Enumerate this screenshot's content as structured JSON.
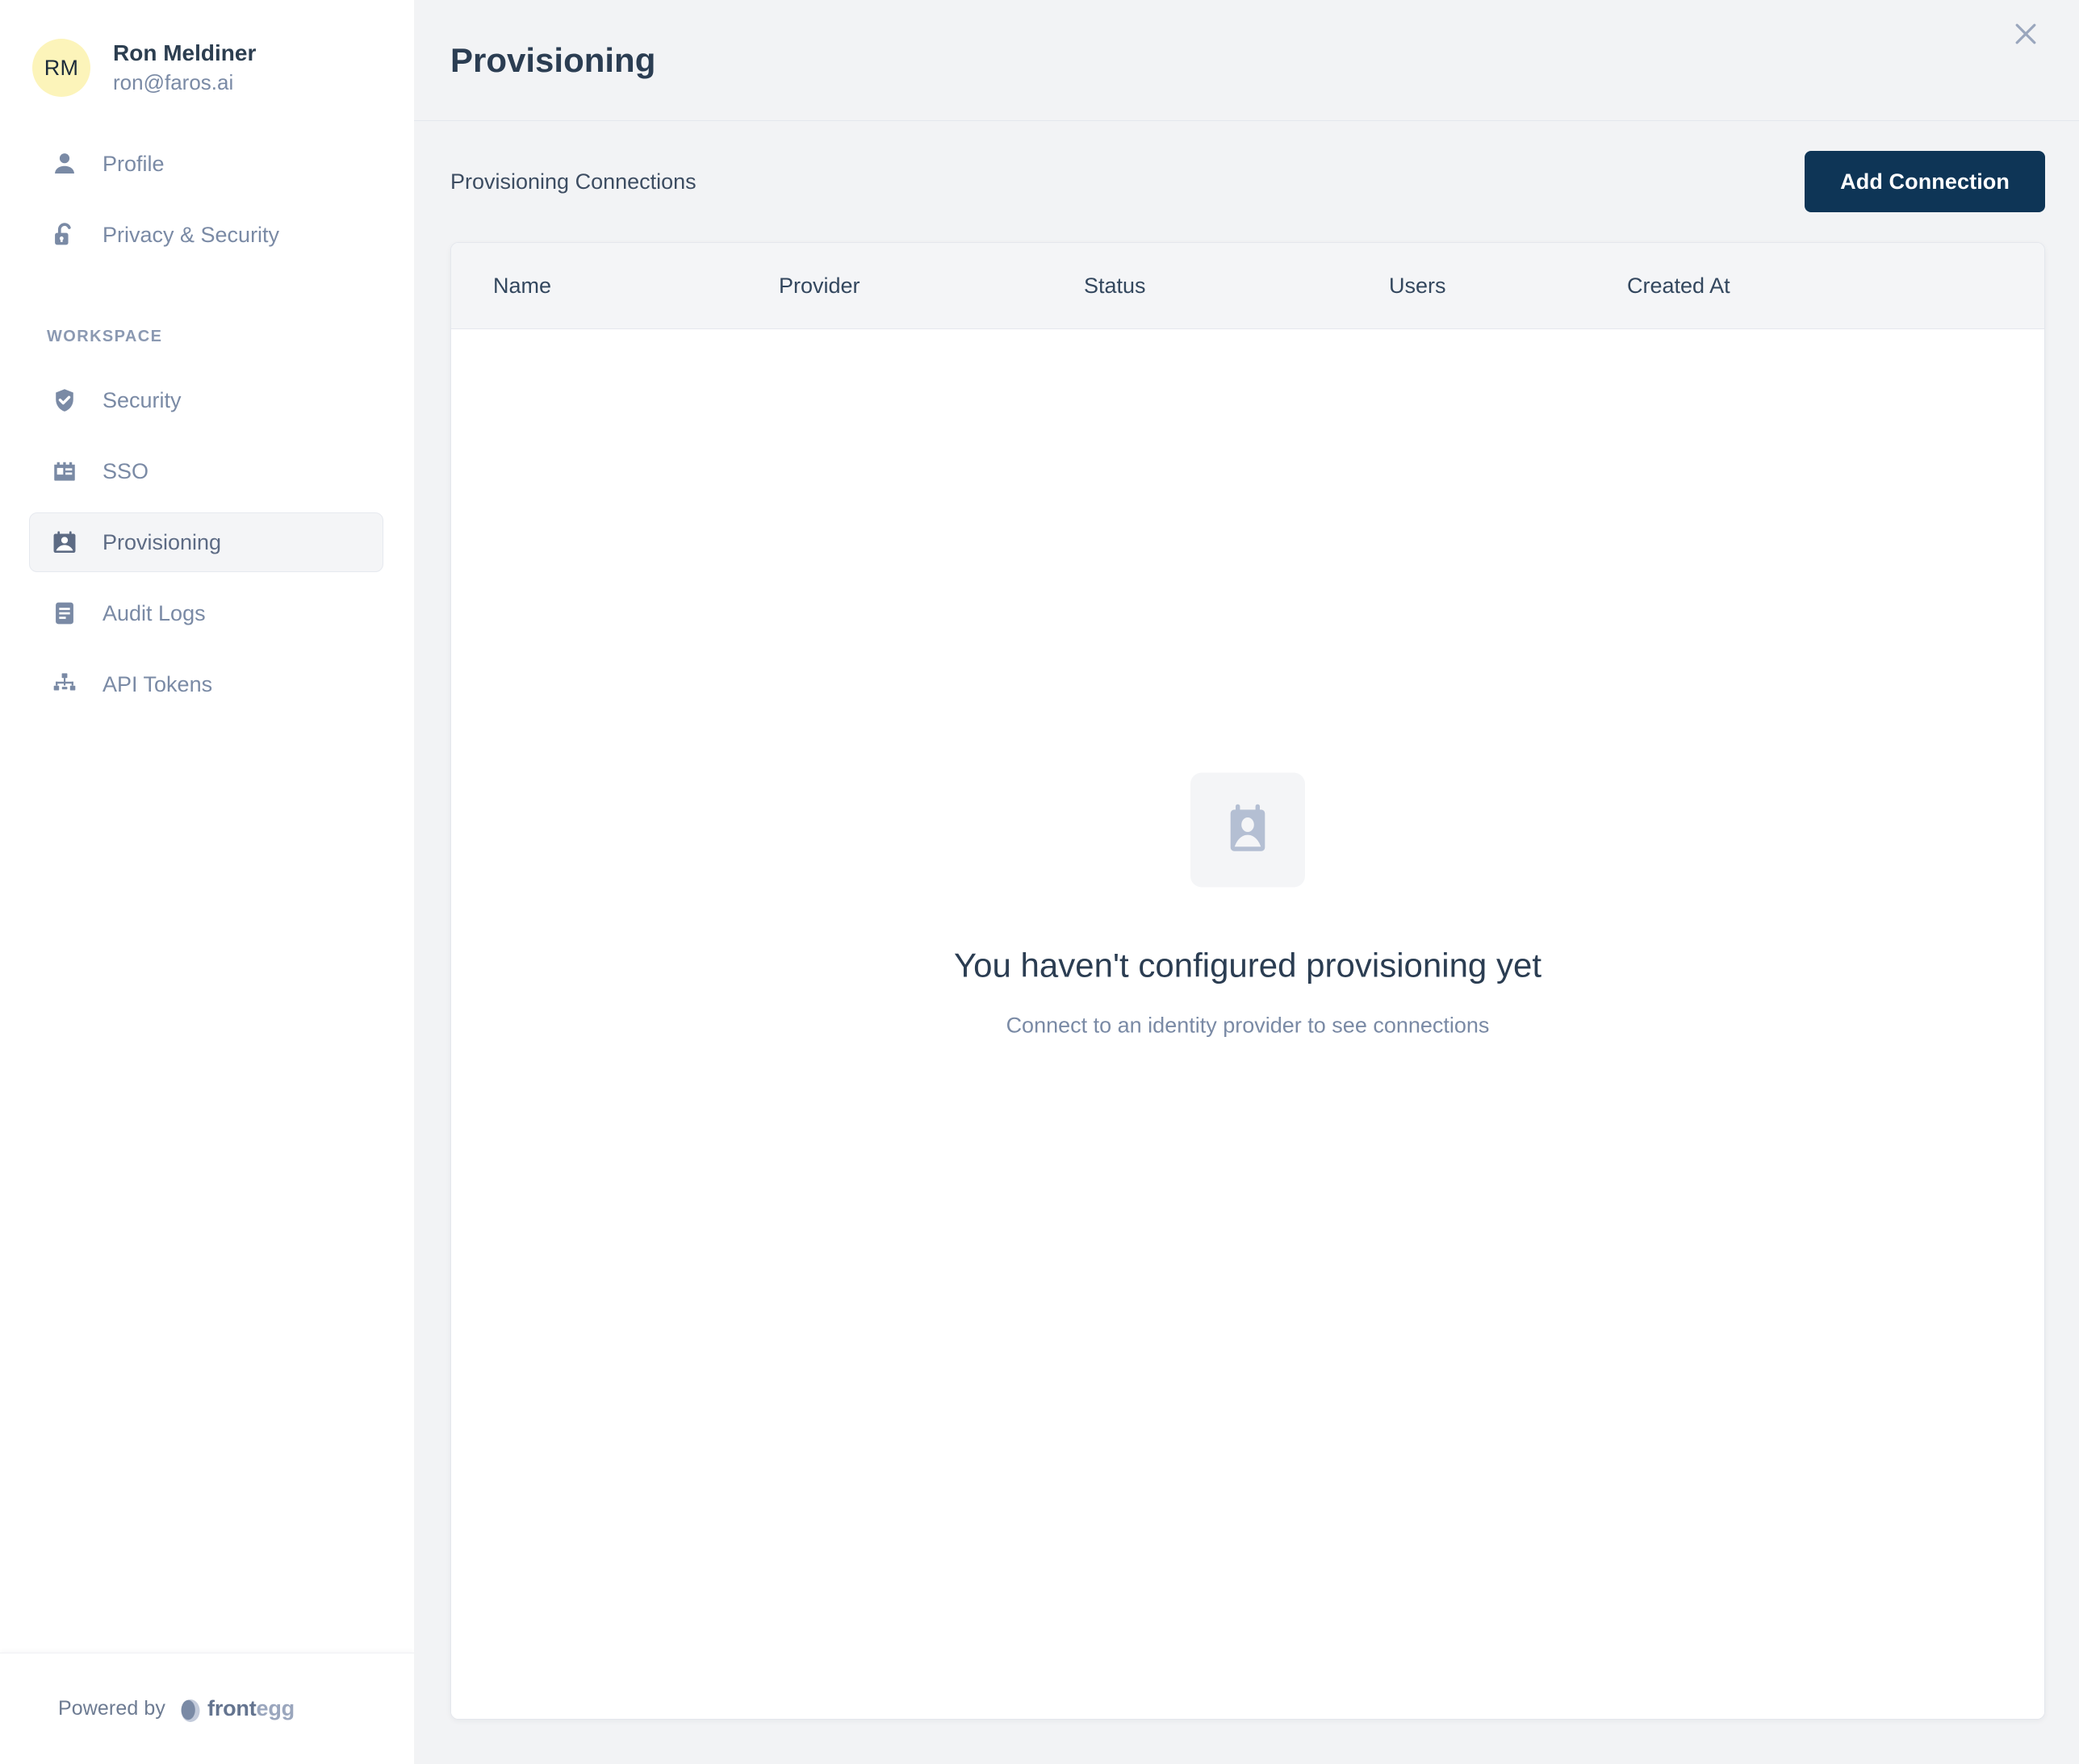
{
  "user": {
    "initials": "RM",
    "name": "Ron Meldiner",
    "email": "ron@faros.ai"
  },
  "sidebar": {
    "account_items": [
      {
        "label": "Profile",
        "icon": "person-icon"
      },
      {
        "label": "Privacy & Security",
        "icon": "unlocked-padlock-icon"
      }
    ],
    "section_label": "WORKSPACE",
    "workspace_items": [
      {
        "label": "Security",
        "icon": "shield-check-icon",
        "active": false
      },
      {
        "label": "SSO",
        "icon": "id-badge-icon",
        "active": false
      },
      {
        "label": "Provisioning",
        "icon": "user-card-icon",
        "active": true
      },
      {
        "label": "Audit Logs",
        "icon": "document-lines-icon",
        "active": false
      },
      {
        "label": "API Tokens",
        "icon": "sitemap-icon",
        "active": false
      }
    ],
    "footer": {
      "powered_by": "Powered by",
      "brand_bold": "front",
      "brand_light": "egg"
    }
  },
  "header": {
    "title": "Provisioning",
    "close_icon": "close-icon"
  },
  "subheader": {
    "label": "Provisioning Connections",
    "add_button": "Add Connection"
  },
  "table": {
    "columns": [
      "Name",
      "Provider",
      "Status",
      "Users",
      "Created At"
    ],
    "rows": []
  },
  "empty_state": {
    "icon": "user-id-card-icon",
    "title": "You haven't configured provisioning yet",
    "subtitle": "Connect to an identity provider to see connections"
  },
  "colors": {
    "accent_button": "#0e3556",
    "avatar_background": "#fcf4ba",
    "icon_muted": "#7a8aa5",
    "page_background": "#f2f3f5",
    "card_background": "#ffffff",
    "title_text": "#2b3d52"
  }
}
